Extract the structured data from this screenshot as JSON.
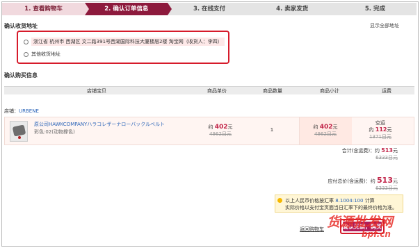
{
  "steps": [
    "1. 查看购物车",
    "2. 确认订单信息",
    "3. 在线支付",
    "4. 卖家发货",
    "5. 完成"
  ],
  "address": {
    "title": "确认收货地址",
    "show_all": "显示全部地址",
    "selected": "浙江省 杭州市 西湖区 文二路391号西湖国际科技大厦楼层2楼 淘宝网（收货人：李四）",
    "other": "其他收货地址"
  },
  "order": {
    "title": "确认购买信息",
    "headers": [
      "店铺宝贝",
      "商品单价",
      "商品数量",
      "商品小计",
      "运费"
    ],
    "shop_label": "店铺：",
    "shop_name": "URBENE",
    "item": {
      "title": "原公司HAWKCOMPANYハラコレザーナローバックルベルト",
      "color": "彩色:02(动物撑色)",
      "price_prefix": "约",
      "price": "402",
      "price_unit": "元",
      "price_orig": "4962日元",
      "quantity": "1",
      "subtotal_prefix": "约",
      "subtotal": "402",
      "subtotal_unit": "元",
      "subtotal_orig": "4962日元",
      "shipping_label": "空运",
      "shipping_prefix": "约",
      "shipping": "112",
      "shipping_unit": "元",
      "shipping_orig": "1371日元"
    },
    "subtotal_label": "合计(含运费)：约",
    "subtotal_value": "513",
    "subtotal_unit": "元",
    "subtotal_orig": "6333日元",
    "total_label": "应付总价(含运费)：约",
    "total_value": "513",
    "total_unit": "元",
    "total_orig": "6333日元"
  },
  "note": {
    "line1_pre": "以上人民币价格按汇率",
    "rate": "8.1004:100",
    "line1_post": "计算",
    "line2": "实际价格以支付宝页面当日汇率下的最终价格为准。"
  },
  "actions": {
    "back": "返回购物车",
    "confirm": "确认无误，购买"
  },
  "watermark": {
    "main": "货源批发网",
    "sub": "bpf.cn"
  }
}
